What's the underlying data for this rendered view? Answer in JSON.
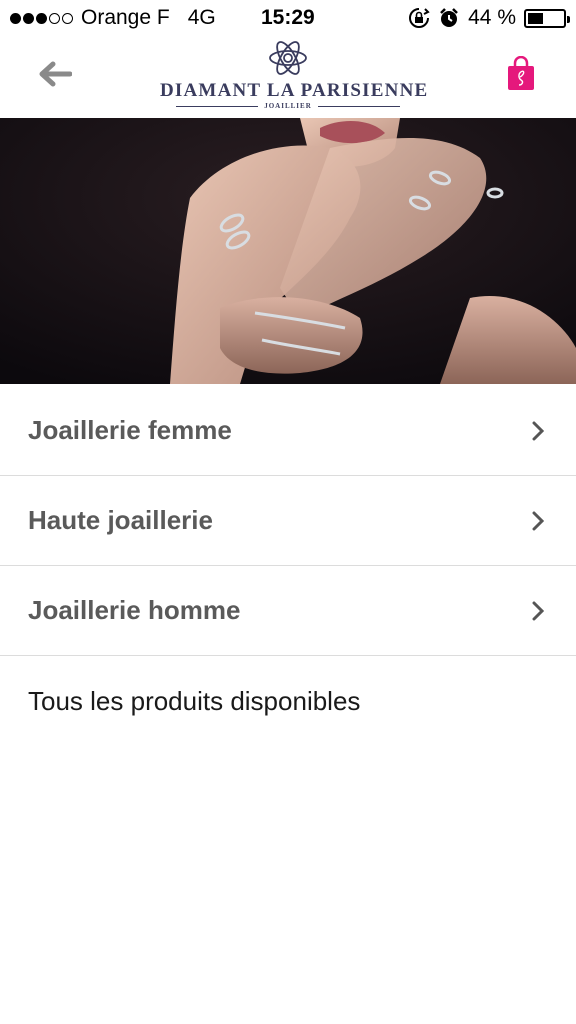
{
  "status_bar": {
    "signal_bars": 5,
    "signal_filled": 3,
    "carrier": "Orange F",
    "network": "4G",
    "time": "15:29",
    "battery_percent": "44 %",
    "battery_level": 0.44
  },
  "header": {
    "brand_name": "DIAMANT LA PARISIENNE",
    "brand_tagline": "JOAILLIER",
    "cart_color": "#e5187c"
  },
  "menu": {
    "items": [
      {
        "label": "Joaillerie femme"
      },
      {
        "label": "Haute joaillerie"
      },
      {
        "label": "Joaillerie homme"
      },
      {
        "label": "Tous les produits disponibles"
      }
    ]
  }
}
